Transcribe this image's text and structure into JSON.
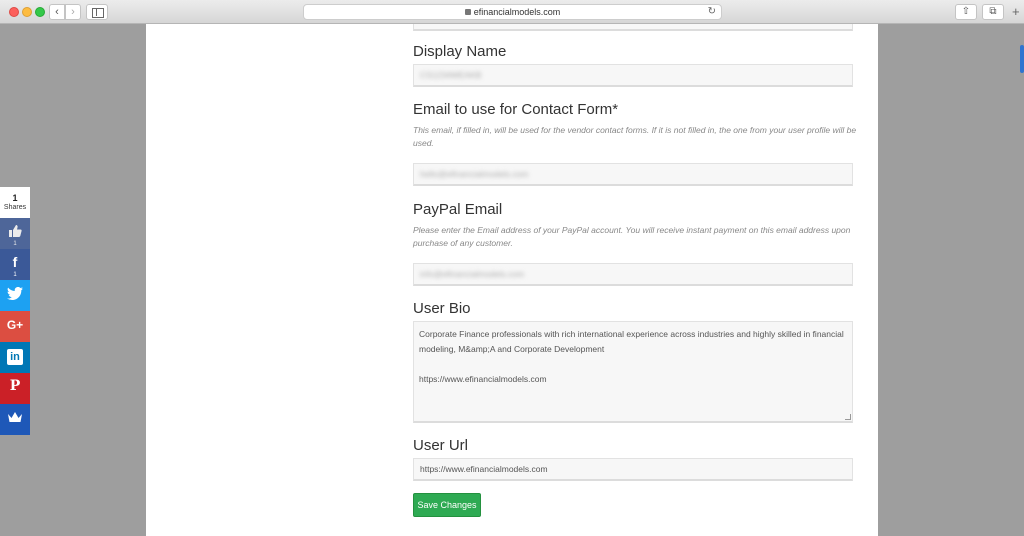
{
  "browser": {
    "url": "efinancialmodels.com",
    "back_icon": "chevron-left-icon",
    "forward_icon": "chevron-right-icon"
  },
  "form": {
    "display_name": {
      "label": "Display Name",
      "value": "CS1234WEAKB"
    },
    "contact_email": {
      "label": "Email to use for Contact Form*",
      "help": "This email, if filled in, will be used for the vendor contact forms. If it is not filled in, the one from your user profile will be used.",
      "value": "hello@efinancialmodels.com"
    },
    "paypal_email": {
      "label": "PayPal Email",
      "help": "Please enter the Email address of your PayPal account. You will receive instant payment on this email address upon purchase of any customer.",
      "value": "info@efinancialmodels.com"
    },
    "user_bio": {
      "label": "User Bio",
      "value": "Corporate Finance professionals with rich international experience across industries and highly skilled in financial modeling, M&amp;A and Corporate Development\n\nhttps://www.efinancialmodels.com"
    },
    "user_url": {
      "label": "User Url",
      "value": "https://www.efinancialmodels.com"
    },
    "save_label": "Save Changes"
  },
  "share": {
    "total": "1",
    "total_label": "Shares",
    "like_count": "1",
    "facebook_count": "1",
    "googleplus_glyph": "G+",
    "facebook_glyph": "f",
    "linkedin_glyph": "in",
    "pinterest_glyph": "P"
  }
}
